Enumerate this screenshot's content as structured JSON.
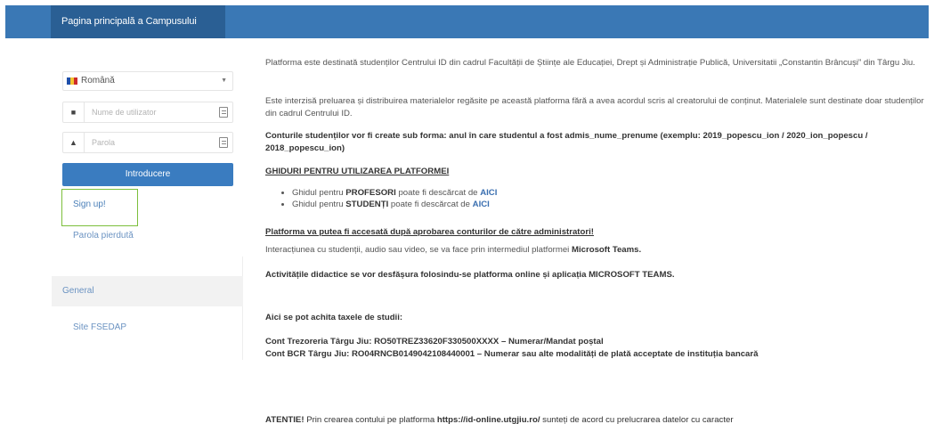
{
  "header": {
    "home_tab": "Pagina principală a Campusului"
  },
  "login": {
    "language": "Română",
    "username_placeholder": "Nume de utilizator",
    "password_placeholder": "Parola",
    "login_button": "Introducere",
    "signup_link": "Sign up!",
    "forgot_link": "Parola pierdută"
  },
  "sidebar": {
    "general_heading": "General",
    "site_link": "Site FSEDAP"
  },
  "content": {
    "p1": "Platforma este destinată studenților Centrului ID din cadrul Facultății de Științe ale Educației, Drept și Administrație Publică, Universitatii „Constantin Brâncuși” din Târgu Jiu.",
    "p2": "Este interzisă preluarea și distribuirea materialelor regăsite pe această platforma fără a avea acordul scris al creatorului de conținut. Materialele sunt destinate doar studenților din cadrul Centrului ID.",
    "p3": "Conturile studenților vor fi create sub forma: anul în care studentul a fost admis_nume_prenume (exemplu: 2019_popescu_ion / 2020_ion_popescu / 2018_popescu_ion)",
    "guides_heading": "GHIDURI PENTRU UTILIZAREA PLATFORMEI",
    "guide1_prefix": "Ghidul pentru ",
    "guide1_role": "PROFESORI",
    "guide1_mid": " poate fi descărcat de ",
    "guide1_link": "AICI",
    "guide2_prefix": "Ghidul pentru ",
    "guide2_role": "STUDENȚI",
    "guide2_mid": " poate fi descărcat de ",
    "guide2_link": "AICI",
    "access_note": "Platforma va putea fi accesată după aprobarea conturilor de către administratori!",
    "interaction_prefix": "Interacțiunea cu studenții, audio sau video, se va face prin intermediul platformei ",
    "interaction_platform": "Microsoft Teams.",
    "activities": "Activitățile didactice se vor desfășura folosindu-se platforma online și aplicația MICROSOFT TEAMS.",
    "fees_heading": "Aici se pot achita taxele de studii:",
    "treasury": "Cont Trezoreria Târgu Jiu: RO50TREZ33620F330500XXXX – Numerar/Mandat poștal",
    "bcr": "Cont BCR Târgu Jiu: RO04RNCB0149042108440001 – Numerar sau alte modalități de plată acceptate de instituția bancară",
    "attention_prefix": "ATENTIE!",
    "attention_text": " Prin crearea contului pe platforma ",
    "attention_url": "https://id-online.utgjiu.ro/",
    "attention_rest": " sunteți de acord cu prelucrarea datelor cu caracter"
  },
  "colors": {
    "header_blue": "#3a78b5",
    "button_blue": "#3a7cc0",
    "link_blue": "#4a7fb8",
    "highlight_green": "#7cbf3c"
  },
  "icons": {
    "language_flag": "romania-flag-icon",
    "username_icon": "user-icon",
    "password_icon": "lock-icon",
    "keyboard_icon": "keyboard-icon"
  }
}
